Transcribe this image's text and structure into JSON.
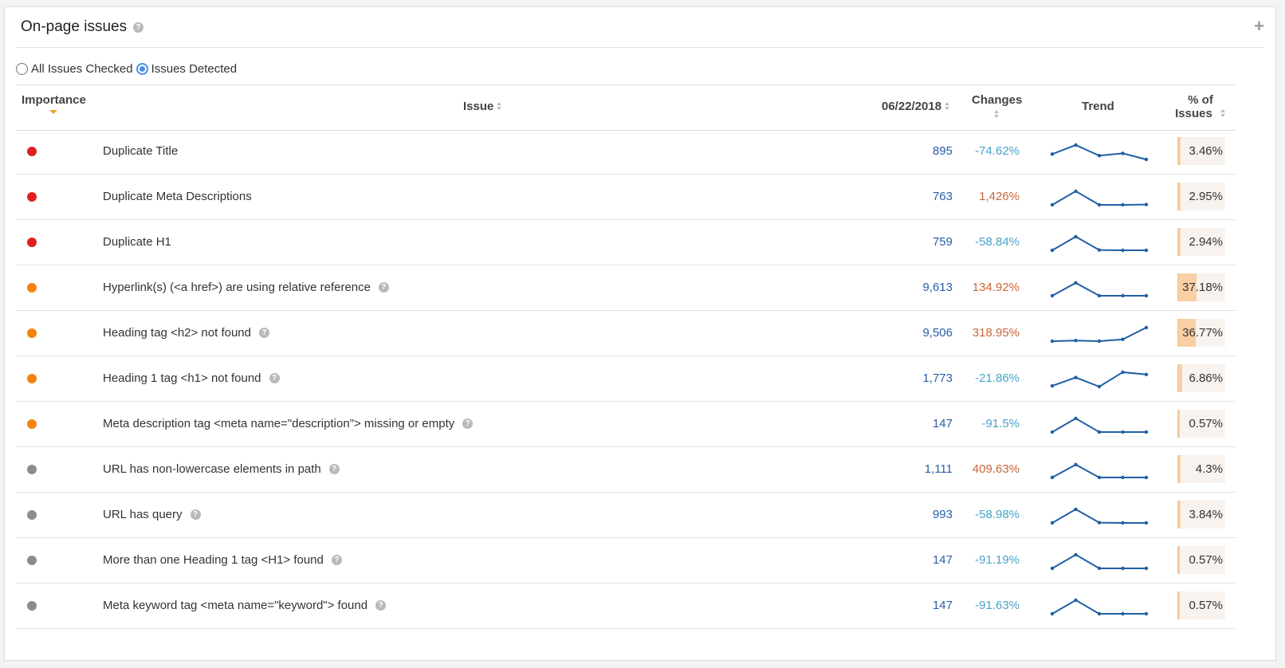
{
  "panel": {
    "title": "On-page issues",
    "add_label": "+"
  },
  "filters": [
    {
      "label": "All Issues Checked",
      "checked": false
    },
    {
      "label": "Issues Detected",
      "checked": true
    }
  ],
  "columns": {
    "importance": "Importance",
    "issue": "Issue",
    "date": "06/22/2018",
    "changes": "Changes",
    "trend": "Trend",
    "pct_line1": "% of",
    "pct_line2": "Issues"
  },
  "colors": {
    "high": "#e02020",
    "medium": "#f5820d",
    "low": "#8c8c8c",
    "negative_change": "#4aa3c9",
    "positive_change": "#c9653b",
    "trend_line": "#1f5fa3"
  },
  "rows": [
    {
      "importance": "high",
      "issue": "Duplicate Title",
      "help": false,
      "count": "895",
      "change": "-74.62%",
      "change_dir": "down",
      "trend": [
        0.35,
        0.95,
        0.25,
        0.4,
        0.0
      ],
      "pct": "3.46%",
      "pct_value": 3.46
    },
    {
      "importance": "high",
      "issue": "Duplicate Meta Descriptions",
      "help": false,
      "count": "763",
      "change": "1,426%",
      "change_dir": "up",
      "trend": [
        0.0,
        0.9,
        0.0,
        0.0,
        0.02
      ],
      "pct": "2.95%",
      "pct_value": 2.95
    },
    {
      "importance": "high",
      "issue": "Duplicate H1",
      "help": false,
      "count": "759",
      "change": "-58.84%",
      "change_dir": "down",
      "trend": [
        0.0,
        0.9,
        0.02,
        0.0,
        0.0
      ],
      "pct": "2.94%",
      "pct_value": 2.94
    },
    {
      "importance": "medium",
      "issue": "Hyperlink(s) (<a href>) are using relative reference",
      "help": true,
      "count": "9,613",
      "change": "134.92%",
      "change_dir": "up",
      "trend": [
        0.0,
        0.85,
        0.0,
        0.0,
        0.0
      ],
      "pct": "37.18%",
      "pct_value": 37.18
    },
    {
      "importance": "medium",
      "issue": "Heading tag <h2> not found",
      "help": true,
      "count": "9,506",
      "change": "318.95%",
      "change_dir": "up",
      "trend": [
        0.0,
        0.04,
        0.0,
        0.12,
        0.9
      ],
      "pct": "36.77%",
      "pct_value": 36.77
    },
    {
      "importance": "medium",
      "issue": "Heading 1 tag <h1> not found",
      "help": true,
      "count": "1,773",
      "change": "-21.86%",
      "change_dir": "down",
      "trend": [
        0.05,
        0.6,
        0.0,
        0.95,
        0.8
      ],
      "pct": "6.86%",
      "pct_value": 6.86
    },
    {
      "importance": "medium",
      "issue": "Meta description tag <meta name=\"description\"> missing or empty",
      "help": true,
      "count": "147",
      "change": "-91.5%",
      "change_dir": "down",
      "trend": [
        0.0,
        0.9,
        0.0,
        0.0,
        0.0
      ],
      "pct": "0.57%",
      "pct_value": 0.57
    },
    {
      "importance": "low",
      "issue": "URL has non-lowercase elements in path",
      "help": true,
      "count": "1,111",
      "change": "409.63%",
      "change_dir": "up",
      "trend": [
        0.0,
        0.85,
        0.0,
        0.0,
        0.0
      ],
      "pct": "4.3%",
      "pct_value": 4.3
    },
    {
      "importance": "low",
      "issue": "URL has query",
      "help": true,
      "count": "993",
      "change": "-58.98%",
      "change_dir": "down",
      "trend": [
        0.0,
        0.9,
        0.02,
        0.0,
        0.0
      ],
      "pct": "3.84%",
      "pct_value": 3.84
    },
    {
      "importance": "low",
      "issue": "More than one Heading 1 tag <H1> found",
      "help": true,
      "count": "147",
      "change": "-91.19%",
      "change_dir": "down",
      "trend": [
        0.0,
        0.9,
        0.0,
        0.0,
        0.0
      ],
      "pct": "0.57%",
      "pct_value": 0.57
    },
    {
      "importance": "low",
      "issue": "Meta keyword tag <meta name=\"keyword\"> found",
      "help": true,
      "count": "147",
      "change": "-91.63%",
      "change_dir": "down",
      "trend": [
        0.0,
        0.9,
        0.0,
        0.0,
        0.0
      ],
      "pct": "0.57%",
      "pct_value": 0.57
    }
  ]
}
